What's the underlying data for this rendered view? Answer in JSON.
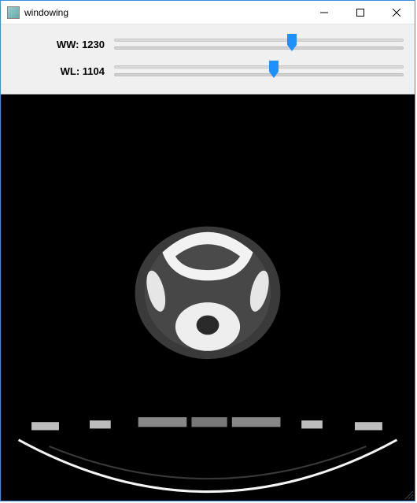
{
  "window": {
    "title": "windowing",
    "icon_name": "windowing-app-icon"
  },
  "controls": {
    "ww": {
      "label_prefix": "WW:",
      "value": 1230,
      "min": 0,
      "max": 2000
    },
    "wl": {
      "label_prefix": "WL:",
      "value": 1104,
      "min": 0,
      "max": 2000
    }
  },
  "viewport": {
    "content_type": "ct-axial-slice",
    "background": "#000000"
  }
}
